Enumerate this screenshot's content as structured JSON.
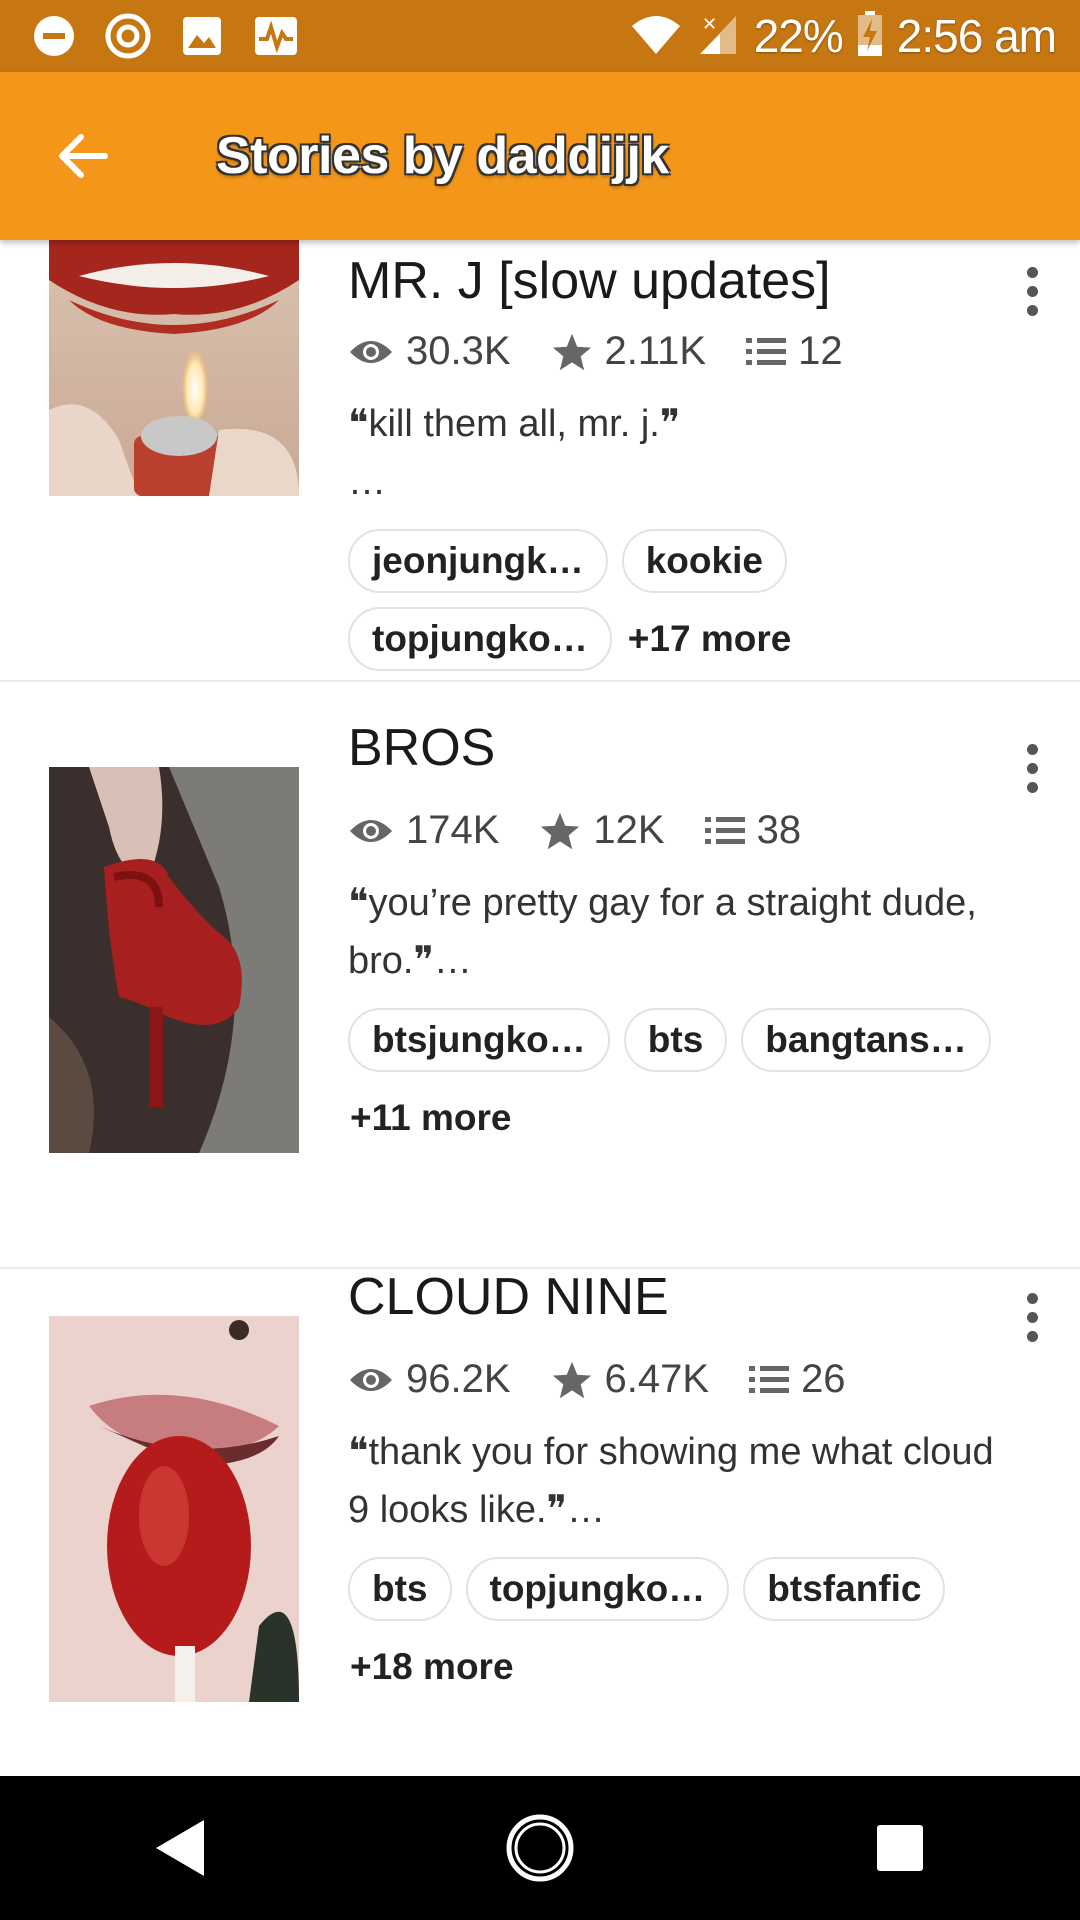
{
  "status_bar": {
    "battery": "22%",
    "time": "2:56 am",
    "icons": [
      "minus-circle-icon",
      "target-icon",
      "image-icon",
      "pulse-icon",
      "wifi-icon",
      "signal-icon",
      "battery-charging-icon"
    ]
  },
  "app_bar": {
    "title": "Stories by daddijjk",
    "back_icon": "arrow-back-icon"
  },
  "stories": [
    {
      "title": "MR. J [slow updates]",
      "views": "30.3K",
      "votes": "2.11K",
      "parts": "12",
      "description": "❝kill them all, mr. j.❞\n…",
      "tags": [
        "jeonjungk…",
        "kookie",
        "topjungko…"
      ],
      "more_tags": "+17 more"
    },
    {
      "title": "BROS",
      "views": "174K",
      "votes": "12K",
      "parts": "38",
      "description": "❝you’re pretty gay for a straight dude, bro.❞…",
      "tags": [
        "btsjungko…",
        "bts",
        "bangtans…"
      ],
      "more_tags": "+11 more"
    },
    {
      "title": "CLOUD NINE",
      "views": "96.2K",
      "votes": "6.47K",
      "parts": "26",
      "description": "❝thank you for showing me what cloud 9 looks like.❞…",
      "tags": [
        "bts",
        "topjungko…",
        "btsfanfic"
      ],
      "more_tags": "+18 more"
    }
  ],
  "nav_bar": {
    "icons": [
      "back-triangle-icon",
      "home-circle-icon",
      "recents-square-icon"
    ]
  },
  "colors": {
    "status_bar": "#C77712",
    "app_bar": "#F4961A",
    "nav_bar": "#000000"
  }
}
